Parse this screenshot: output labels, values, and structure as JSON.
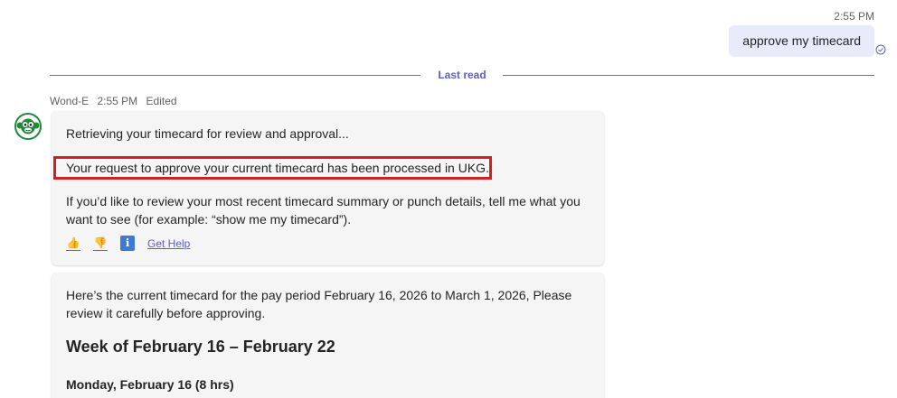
{
  "outgoing": {
    "time": "2:55 PM",
    "text": "approve my timecard"
  },
  "divider": {
    "label": "Last read"
  },
  "bot": {
    "name": "Wond-E",
    "time": "2:55 PM",
    "status": "Edited",
    "message1": {
      "line1": "Retrieving your timecard for review and approval...",
      "line2": "Your request to approve your current timecard has been processed in UKG.",
      "line3": "If you’d like to review your most recent timecard summary or punch details, tell me what you want to see (for example: “show me my timecard”).",
      "actions": {
        "thumbs_up": "👍",
        "thumbs_down": "👎",
        "info": "ℹ",
        "help_label": "Get Help"
      }
    },
    "message2": {
      "intro": "Here’s the current timecard for the pay period February 16, 2026 to March 1, 2026, Please review it carefully before approving.",
      "week_heading": "Week of February 16 – February 22",
      "day_heading": "Monday, February 16 (8 hrs)"
    }
  },
  "colors": {
    "accent": "#5b5fc7",
    "highlight_border": "#d21f1f",
    "outgoing_bubble": "#e8ebfa",
    "card_bg": "#f5f5f5"
  }
}
